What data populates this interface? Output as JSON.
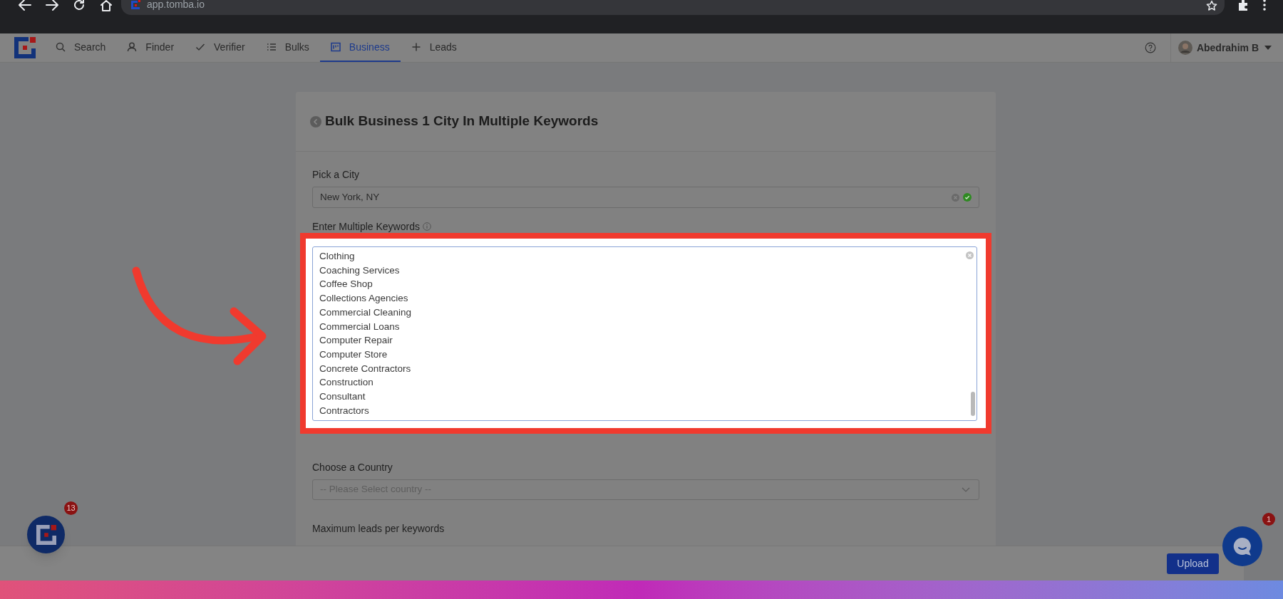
{
  "browser": {
    "url": "app.tomba.io"
  },
  "nav": {
    "items": [
      {
        "label": "Search",
        "selected": false
      },
      {
        "label": "Finder",
        "selected": false
      },
      {
        "label": "Verifier",
        "selected": false
      },
      {
        "label": "Bulks",
        "selected": false
      },
      {
        "label": "Business",
        "selected": true
      },
      {
        "label": "Leads",
        "selected": false
      }
    ],
    "user": {
      "name": "Abedrahim B"
    }
  },
  "page": {
    "title": "Bulk Business 1 City In Multiple Keywords",
    "city": {
      "label": "Pick a City",
      "value": "New York, NY",
      "valid": true
    },
    "keywords": {
      "label": "Enter Multiple Keywords",
      "lines": [
        "Clothing",
        "Coaching Services",
        "Coffee Shop",
        "Collections Agencies",
        "Commercial Cleaning",
        "Commercial Loans",
        "Computer Repair",
        "Computer Store",
        "Concrete Contractors",
        "Construction",
        "Consultant",
        "Contractors"
      ]
    },
    "country": {
      "label": "Choose a Country",
      "placeholder": "-- Please Select country --"
    },
    "max_leads": {
      "label": "Maximum leads per keywords"
    }
  },
  "footer": {
    "button": "Upload"
  },
  "widgets": {
    "app_badge": "13",
    "chat_badge": "1"
  }
}
